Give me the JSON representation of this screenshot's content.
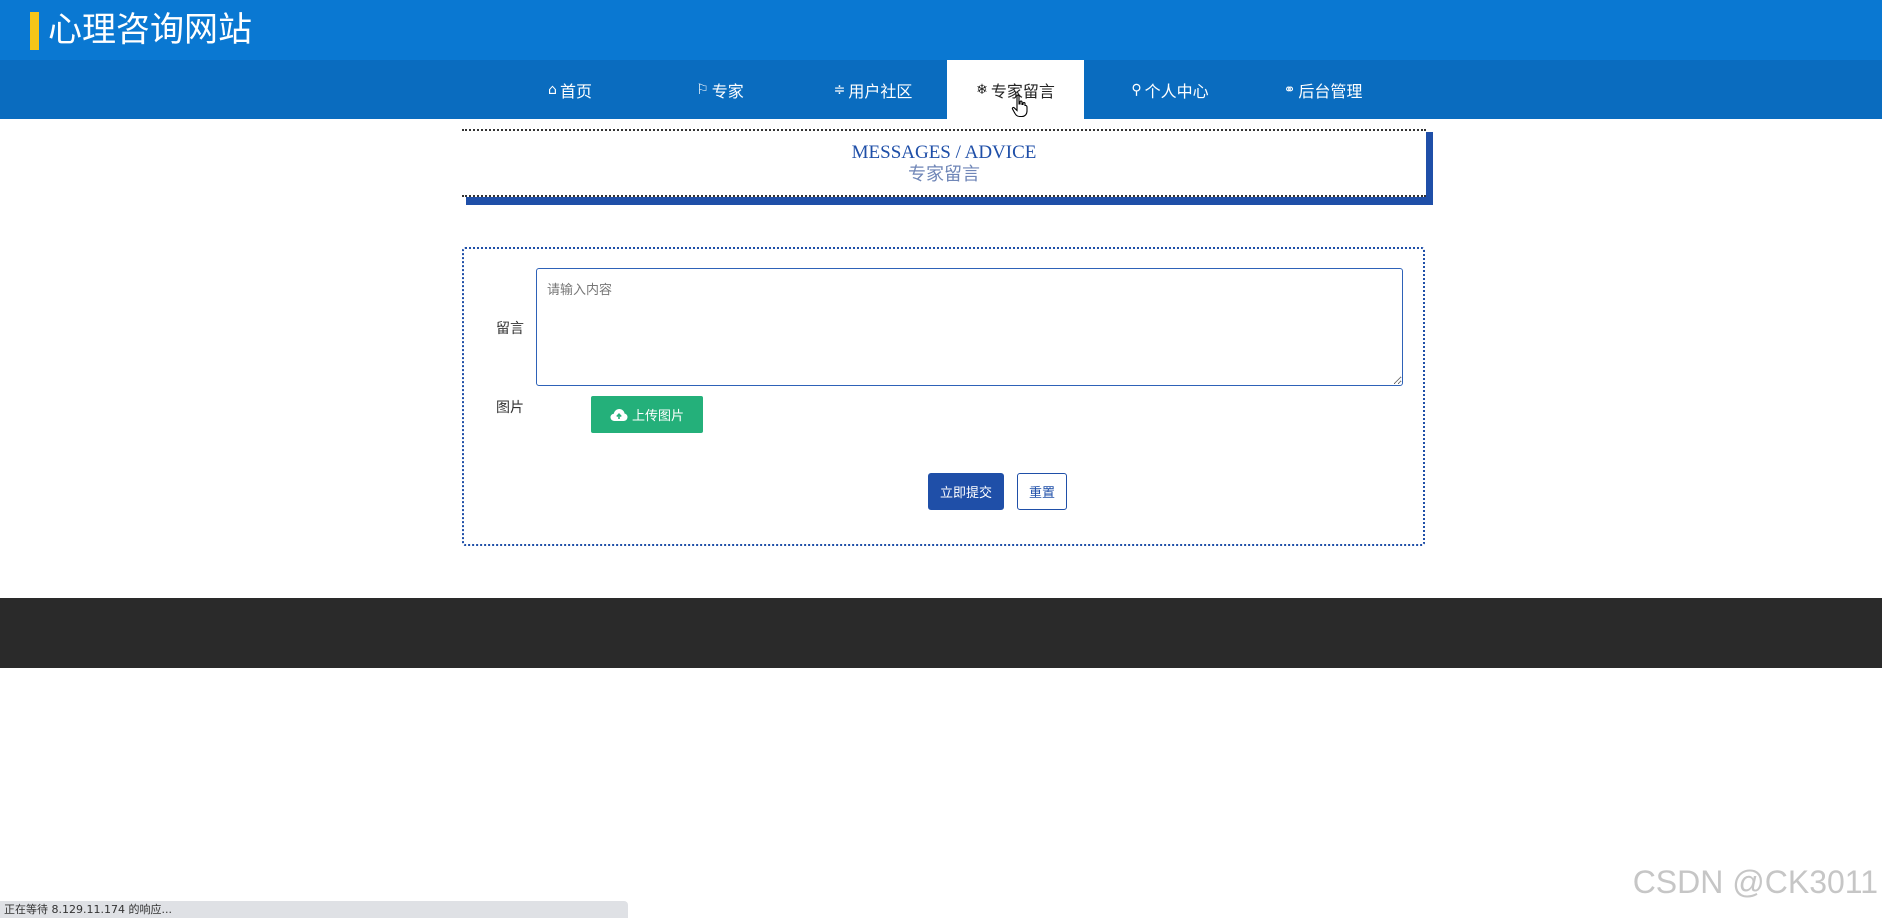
{
  "header": {
    "site_title": "心理咨询网站"
  },
  "nav": {
    "items": [
      {
        "icon": "⌂",
        "label": "首页"
      },
      {
        "icon": "⚐",
        "label": "专家"
      },
      {
        "icon": "≑",
        "label": "用户社区"
      },
      {
        "icon": "❄",
        "label": "专家留言",
        "active": true
      },
      {
        "icon": "⚲",
        "label": "个人中心"
      },
      {
        "icon": "⚭",
        "label": "后台管理"
      }
    ]
  },
  "section": {
    "title_en": "MESSAGES / ADVICE",
    "title_cn": "专家留言"
  },
  "form": {
    "message_label": "留言",
    "message_placeholder": "请输入内容",
    "message_value": "",
    "image_label": "图片",
    "upload_label": "上传图片",
    "submit_label": "立即提交",
    "reset_label": "重置"
  },
  "status_bar": {
    "text": "正在等待 8.129.11.174 的响应..."
  },
  "watermark": {
    "text": "CSDN @CK3011"
  },
  "colors": {
    "header_bg": "#0a78d2",
    "nav_bg": "#0a6cbf",
    "accent": "#1f4fa8",
    "title_marker": "#f5c518",
    "upload_green": "#24b07a",
    "footer_bg": "#2a2a2a"
  }
}
